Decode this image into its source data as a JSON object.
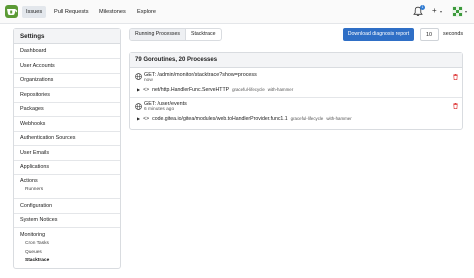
{
  "nav": {
    "items": [
      "Issues",
      "Pull Requests",
      "Milestones",
      "Explore"
    ],
    "notification_count": "1",
    "plus_icon": "+"
  },
  "sidebar": {
    "title": "Settings",
    "items": [
      "Dashboard",
      "User Accounts",
      "Organizations",
      "Repositories",
      "Packages",
      "Webhooks",
      "Authentication Sources",
      "User Emails",
      "Applications",
      "Actions",
      "Configuration",
      "System Notices",
      "Monitoring"
    ],
    "actions_sub": [
      "Runners"
    ],
    "monitoring_sub": [
      "Cron Tasks",
      "Queues",
      "Stacktrace"
    ]
  },
  "tabs": [
    "Running Processes",
    "Stacktrace"
  ],
  "toolbar": {
    "download_label": "Download diagnosis report",
    "seconds_value": "10",
    "seconds_label": "seconds"
  },
  "panel": {
    "header": "79 Goroutines, 20 Processes",
    "processes": [
      {
        "request": "GET: /admin/monitor/stacktrace?show=process",
        "time": "now",
        "stack": {
          "func": "net/http.HandlerFunc.ServeHTTP",
          "labels": [
            "graceful-lifecycle",
            "with-hammer"
          ]
        }
      },
      {
        "request": "GET: /user/events",
        "time": "6 minutes ago",
        "stack": {
          "func": "code.gitea.io/gitea/modules/web.toHandlerProvider.func1.1",
          "labels": [
            "graceful-lifecycle",
            "with-hammer"
          ]
        }
      }
    ]
  },
  "colors": {
    "primary": "#2f6fc6",
    "danger": "#db2828",
    "logo": "#5b9a35"
  }
}
